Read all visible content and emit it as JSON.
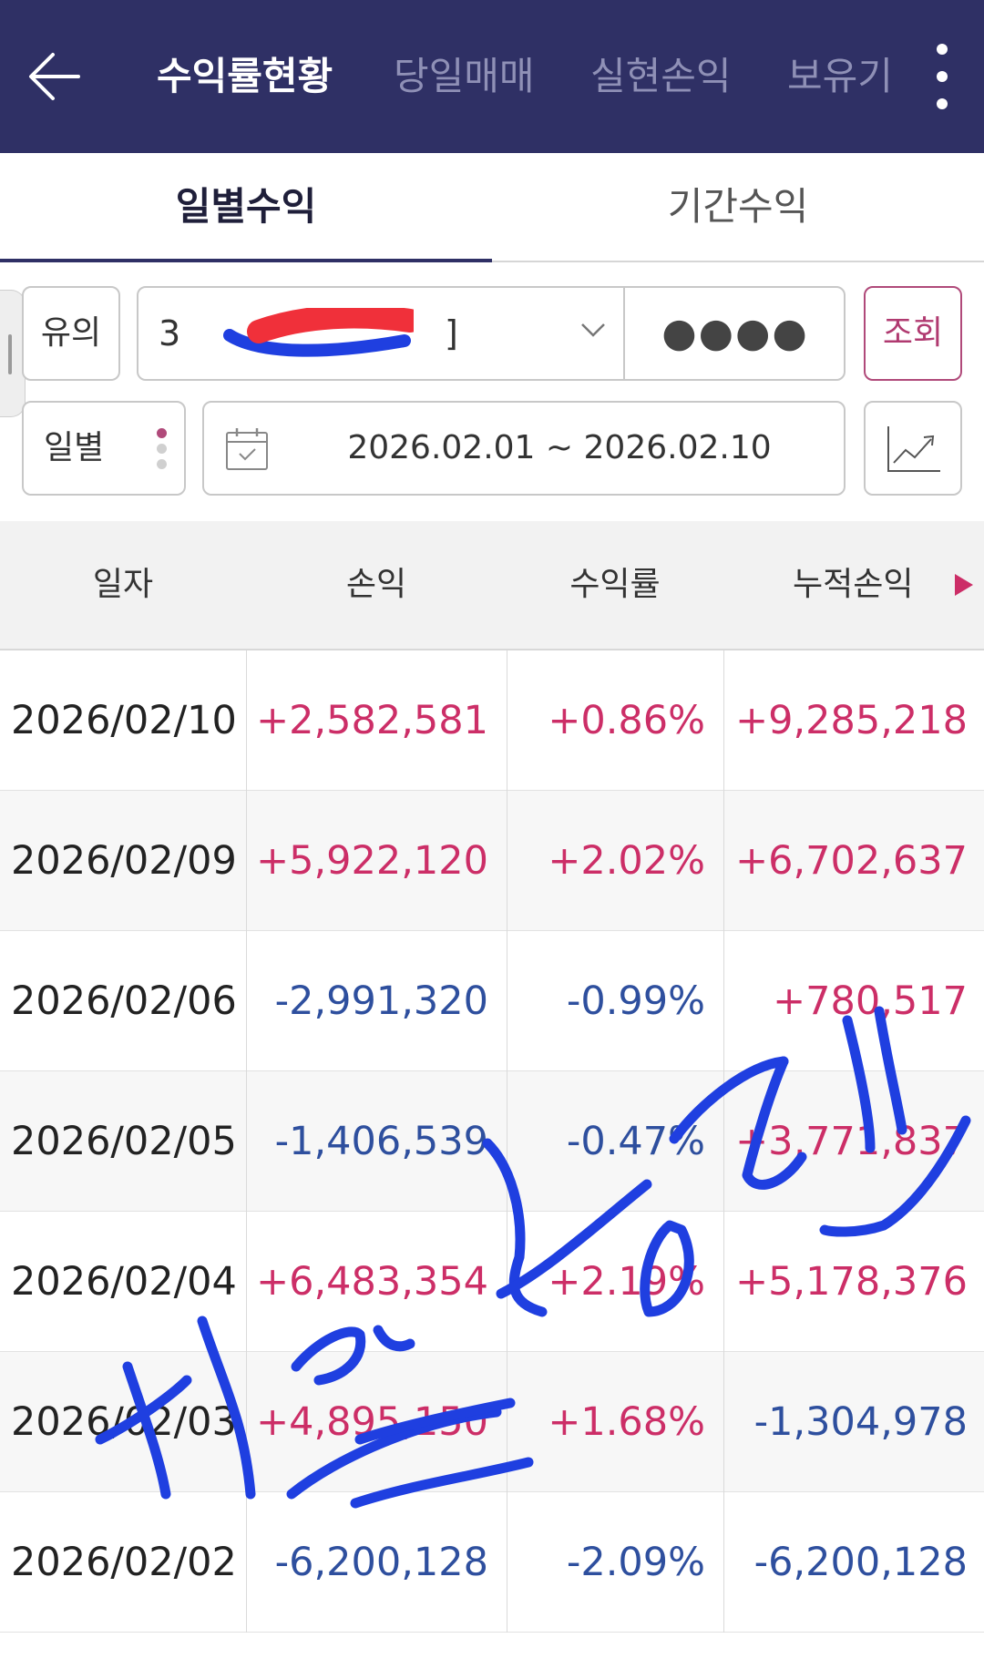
{
  "header": {
    "tabs": [
      {
        "label": "수익률현황",
        "active": true
      },
      {
        "label": "당일매매",
        "active": false
      },
      {
        "label": "실현손익",
        "active": false
      },
      {
        "label": "보유기",
        "active": false
      }
    ],
    "back_icon": "arrow-left-icon",
    "menu_icon": "kebab-menu-icon"
  },
  "subtabs": [
    {
      "label": "일별수익",
      "active": true
    },
    {
      "label": "기간수익",
      "active": false
    }
  ],
  "filters": {
    "account_type": "유의",
    "account_number_prefix": "3",
    "account_number_suffix": "]",
    "password_mask": "●●●●",
    "query_button": "조회",
    "period": "일별",
    "date_range": "2026.02.01 ~ 2026.02.10"
  },
  "table": {
    "columns": [
      "일자",
      "손익",
      "수익률",
      "누적손익"
    ],
    "rows": [
      {
        "date": "2026/02/10",
        "pl": "+2,582,581",
        "rate": "+0.86%",
        "cum": "+9,285,218"
      },
      {
        "date": "2026/02/09",
        "pl": "+5,922,120",
        "rate": "+2.02%",
        "cum": "+6,702,637"
      },
      {
        "date": "2026/02/06",
        "pl": "-2,991,320",
        "rate": "-0.99%",
        "cum": "+780,517"
      },
      {
        "date": "2026/02/05",
        "pl": "-1,406,539",
        "rate": "-0.47%",
        "cum": "+3,771,837"
      },
      {
        "date": "2026/02/04",
        "pl": "+6,483,354",
        "rate": "+2.19%",
        "cum": "+5,178,376"
      },
      {
        "date": "2026/02/03",
        "pl": "+4,895,150",
        "rate": "+1.68%",
        "cum": "-1,304,978"
      },
      {
        "date": "2026/02/02",
        "pl": "-6,200,128",
        "rate": "-2.09%",
        "cum": "-6,200,128"
      }
    ]
  },
  "colors": {
    "header_bg": "#2f3065",
    "positive": "#cc2e67",
    "negative": "#2e4f9e",
    "accent": "#b04a7a",
    "redaction_red": "#f0303a",
    "pen_blue": "#1f3fe0"
  }
}
